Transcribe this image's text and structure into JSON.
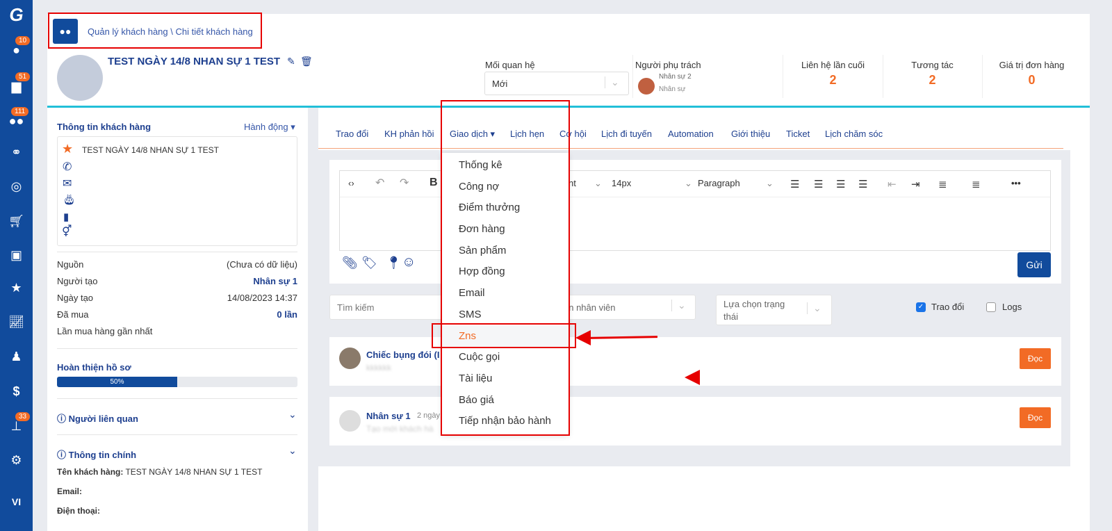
{
  "sidebar": {
    "items": [
      {
        "icon": "logo-icon"
      },
      {
        "icon": "user-icon",
        "badge": "10"
      },
      {
        "icon": "briefcase-icon",
        "badge": "51"
      },
      {
        "icon": "users-icon",
        "badge": "111"
      },
      {
        "icon": "handshake-icon"
      },
      {
        "icon": "target-icon"
      },
      {
        "icon": "cart-icon"
      },
      {
        "icon": "cubes-icon"
      },
      {
        "icon": "star-icon"
      },
      {
        "icon": "chart-icon"
      },
      {
        "icon": "user-tie-icon"
      },
      {
        "icon": "dollar-icon"
      },
      {
        "icon": "sitemap-icon",
        "badge": "33"
      },
      {
        "icon": "gear-icon"
      }
    ],
    "language": "VI"
  },
  "breadcrumb": "Quản lý khách hàng \\ Chi tiết khách hàng",
  "customer": {
    "name": "TEST NGÀY 14/8 NHAN SỰ 1 TEST"
  },
  "header": {
    "relationship_label": "Mối quan hệ",
    "relationship_value": "Mới",
    "owner_label": "Người phụ trách",
    "owner_name": "Nhân sự 2",
    "owner_role": "Nhân sự",
    "stats": [
      {
        "label": "Liên hệ lần cuối",
        "value": "2"
      },
      {
        "label": "Tương tác",
        "value": "2"
      },
      {
        "label": "Giá trị đơn hàng",
        "value": "0"
      }
    ]
  },
  "left": {
    "info_title": "Thông tin khách hàng",
    "action": "Hành động",
    "info_name": "TEST NGÀY 14/8 NHAN SỰ 1 TEST",
    "rows": [
      {
        "label": "Nguồn",
        "value": "(Chưa có dữ liệu)"
      },
      {
        "label": "Người tạo",
        "value": "Nhân sự 1"
      },
      {
        "label": "Ngày tạo",
        "value": "14/08/2023 14:37"
      },
      {
        "label": "Đã mua",
        "value": "0 lần"
      },
      {
        "label": "Lần mua hàng gần nhất",
        "value": ""
      }
    ],
    "progress_title": "Hoàn thiện hồ sơ",
    "progress_percent": 50,
    "progress_text": "50%",
    "related": "Người liên quan",
    "main_info": "Thông tin chính",
    "fields": [
      {
        "label": "Tên khách hàng:",
        "value": "TEST NGÀY 14/8 NHAN SỰ 1 TEST"
      },
      {
        "label": "Email:",
        "value": ""
      },
      {
        "label": "Điện thoại:",
        "value": ""
      }
    ]
  },
  "tabs": [
    "Trao đổi",
    "KH phản hồi",
    "Giao dịch",
    "Lịch hẹn",
    "Cơ hội",
    "Lịch đi tuyến",
    "Automation",
    "Giới thiệu",
    "Ticket",
    "Lịch chăm sóc"
  ],
  "editor": {
    "bold": "B",
    "font_partial": "nt",
    "size": "14px",
    "format": "Paragraph",
    "send": "Gửi"
  },
  "dropdown": [
    "Thống kê",
    "Công nợ",
    "Điểm thưởng",
    "Đơn hàng",
    "Sản phẩm",
    "Hợp đồng",
    "Email",
    "SMS",
    "Zns",
    "Cuộc gọi",
    "Tài liệu",
    "Báo giá",
    "Tiếp nhận bảo hành"
  ],
  "filters": {
    "search_placeholder": "Tìm kiếm",
    "staff_placeholder": "ọn nhân viên",
    "status_placeholder": "Lựa chọn trạng thái",
    "chk_trao_doi": "Trao đổi",
    "chk_logs": "Logs"
  },
  "feed": [
    {
      "author": "Chiếc bụng đói (I",
      "time": "",
      "text": "kkkkkk",
      "button": "Đọc"
    },
    {
      "author": "Nhân sự 1",
      "time": "2 ngày",
      "text": "Tạo mới khách hà",
      "button": "Đọc"
    }
  ],
  "colors": {
    "primary": "#114b9c",
    "accent": "#f26b25",
    "highlight": "#e60000"
  }
}
